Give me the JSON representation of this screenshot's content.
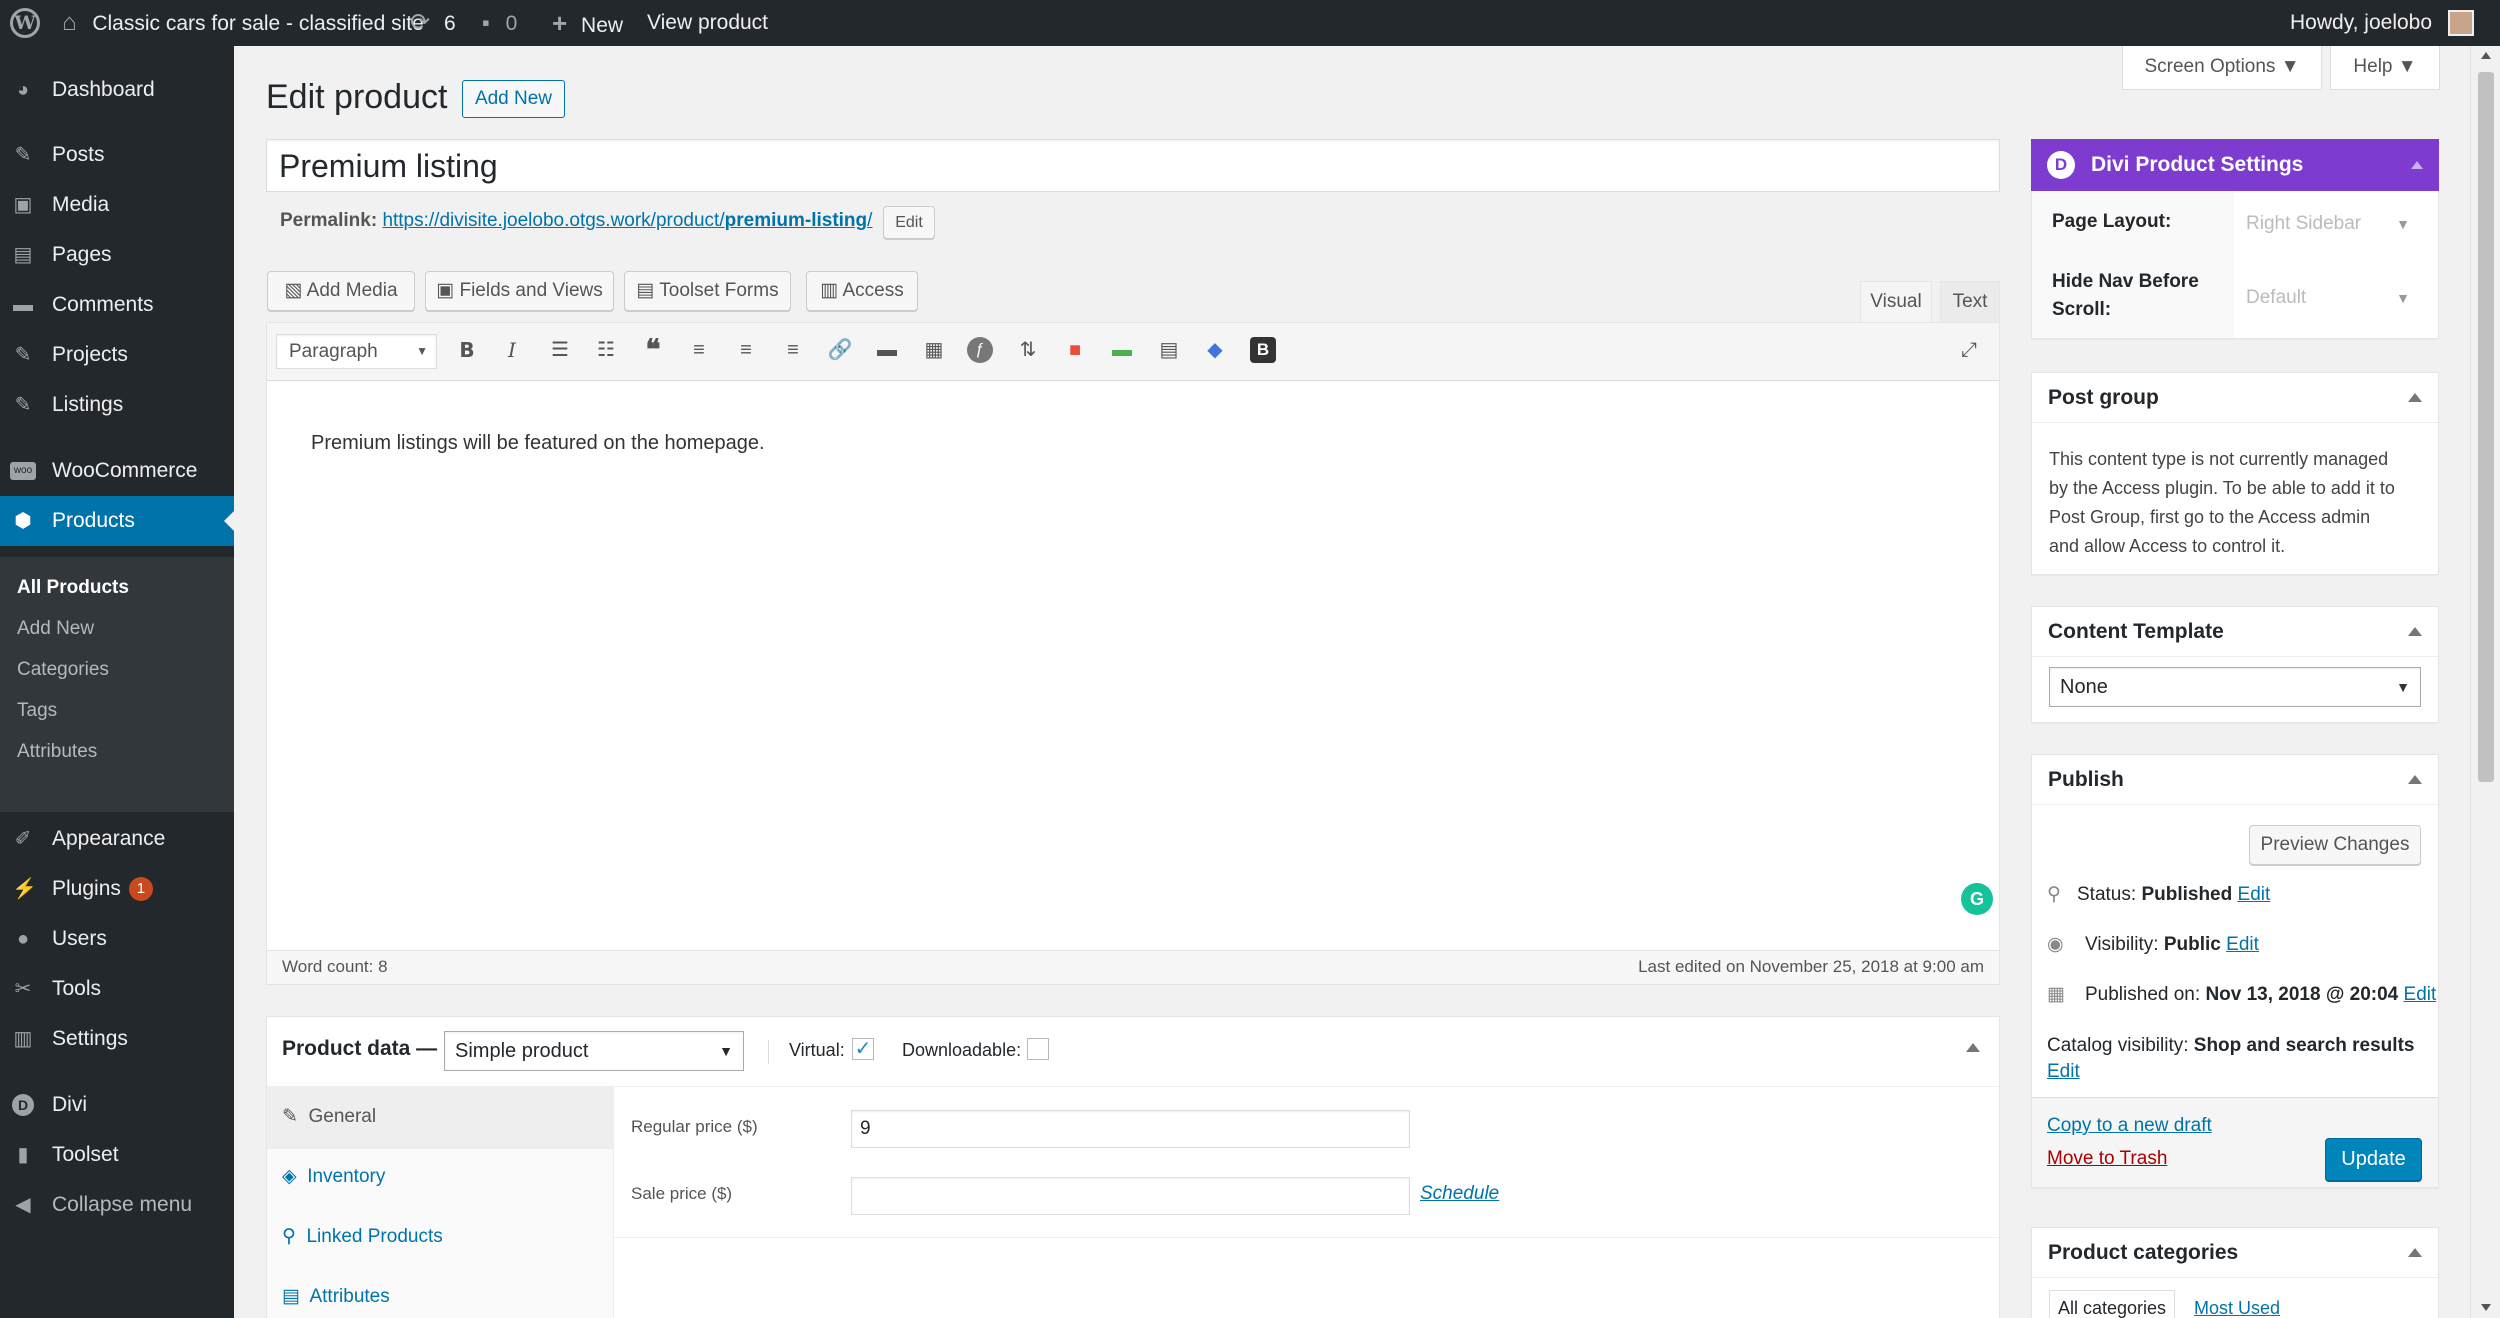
{
  "adminbar": {
    "site_title": "Classic cars for sale - classified site",
    "updates_count": "6",
    "comments_count": "0",
    "new_label": "New",
    "view_label": "View product",
    "howdy": "Howdy, joelobo",
    "wp_logo": "W"
  },
  "sidebar": {
    "items": [
      {
        "label": "Dashboard",
        "icon": "dashboard-icon"
      },
      {
        "label": "Posts",
        "icon": "pin-icon"
      },
      {
        "label": "Media",
        "icon": "media-icon"
      },
      {
        "label": "Pages",
        "icon": "pages-icon"
      },
      {
        "label": "Comments",
        "icon": "comment-icon"
      },
      {
        "label": "Projects",
        "icon": "pin-icon"
      },
      {
        "label": "Listings",
        "icon": "pin-icon"
      },
      {
        "label": "WooCommerce",
        "icon": "woo-icon"
      },
      {
        "label": "Products",
        "icon": "products-icon"
      },
      {
        "label": "Appearance",
        "icon": "brush-icon"
      },
      {
        "label": "Plugins",
        "icon": "plugin-icon",
        "badge": "1"
      },
      {
        "label": "Users",
        "icon": "user-icon"
      },
      {
        "label": "Tools",
        "icon": "wrench-icon"
      },
      {
        "label": "Settings",
        "icon": "settings-icon"
      },
      {
        "label": "Divi",
        "icon": "divi-icon"
      },
      {
        "label": "Toolset",
        "icon": "toolset-icon"
      },
      {
        "label": "Collapse menu",
        "icon": "collapse-icon"
      }
    ],
    "submenu": [
      "All Products",
      "Add New",
      "Categories",
      "Tags",
      "Attributes"
    ],
    "woo_badge": "woo",
    "divi_letter": "D"
  },
  "header": {
    "screen_options": "Screen Options",
    "help": "Help",
    "title": "Edit product",
    "add_new": "Add New"
  },
  "post": {
    "title": "Premium listing",
    "permalink_label": "Permalink:",
    "permalink_base": "https://divisite.joelobo.otgs.work/product/",
    "permalink_slug": "premium-listing",
    "permalink_trail": "/",
    "edit": "Edit"
  },
  "media_buttons": [
    "Add Media",
    "Fields and Views",
    "Toolset Forms",
    "Access"
  ],
  "editor": {
    "tab_visual": "Visual",
    "tab_text": "Text",
    "format": "Paragraph",
    "content": "Premium listings will be featured on the homepage.",
    "word_count": "Word count: 8",
    "last_edited": "Last edited on November 25, 2018 at 9:00 am",
    "grammarly": "G",
    "bold": "B",
    "italic": "I"
  },
  "product_data": {
    "label": "Product data —",
    "type": "Simple product",
    "virtual_label": "Virtual:",
    "downloadable_label": "Downloadable:",
    "virtual_checked": true,
    "downloadable_checked": false,
    "tabs": [
      "General",
      "Inventory",
      "Linked Products",
      "Attributes"
    ],
    "regular_price_label": "Regular price ($)",
    "regular_price": "9",
    "sale_price_label": "Sale price ($)",
    "sale_price": "",
    "schedule": "Schedule"
  },
  "divi_settings": {
    "title": "Divi Product Settings",
    "logo": "D",
    "page_layout_label": "Page Layout:",
    "page_layout": "Right Sidebar",
    "hide_nav_label_1": "Hide Nav Before",
    "hide_nav_label_2": "Scroll:",
    "hide_nav": "Default"
  },
  "post_group": {
    "title": "Post group",
    "text_lines": [
      "This content type is not currently managed",
      "by the Access plugin. To be able to add it to",
      "Post Group, first go to the Access admin",
      "and allow Access to control it."
    ]
  },
  "content_template": {
    "title": "Content Template",
    "value": "None"
  },
  "publish": {
    "title": "Publish",
    "preview": "Preview Changes",
    "status_label": "Status:",
    "status": "Published",
    "visibility_label": "Visibility:",
    "visibility": "Public",
    "published_label": "Published on:",
    "published": "Nov 13, 2018 @ 20:04",
    "catalog_label": "Catalog visibility:",
    "catalog": "Shop and search results",
    "edit": "Edit",
    "copy_draft": "Copy to a new draft",
    "trash": "Move to Trash",
    "update": "Update"
  },
  "categories": {
    "title": "Product categories",
    "tab_all": "All categories",
    "tab_most": "Most Used"
  },
  "colors": {
    "adminbar": "#23282d",
    "accent": "#0073aa",
    "divi_purple": "#7e3bd0",
    "trash": "#a00",
    "badge": "#ca4a1f"
  }
}
